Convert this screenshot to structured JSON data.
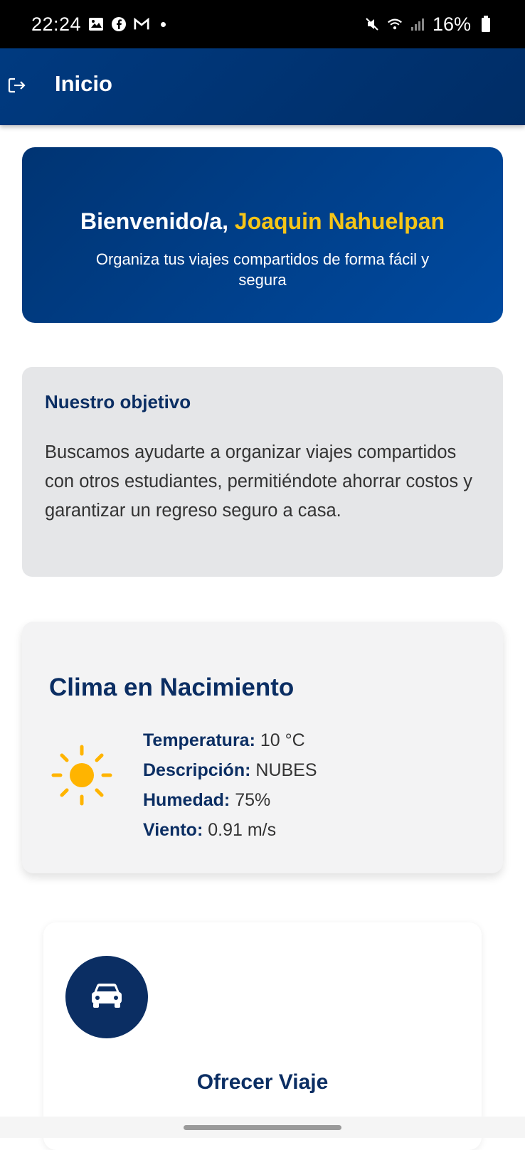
{
  "status_bar": {
    "time": "22:24",
    "battery": "16%",
    "icons": [
      "gallery-icon",
      "facebook-icon",
      "gmail-icon",
      "mute-icon",
      "wifi-icon",
      "signal-icon",
      "battery-icon"
    ]
  },
  "app_bar": {
    "title": "Inicio",
    "logout_icon": "logout-icon"
  },
  "welcome": {
    "greeting": "Bienvenido/a,",
    "name": "Joaquin Nahuelpan",
    "subtitle": "Organiza tus viajes compartidos de forma fácil y segura"
  },
  "objective": {
    "title": "Nuestro objetivo",
    "text": "Buscamos ayudarte a organizar viajes compartidos con otros estudiantes, permitiéndote ahorrar costos y garantizar un regreso seguro a casa."
  },
  "weather": {
    "title": "Clima en Nacimiento",
    "icon": "sun-icon",
    "rows": [
      {
        "label": "Temperatura:",
        "value": "10 °C"
      },
      {
        "label": "Descripción:",
        "value": "NUBES"
      },
      {
        "label": "Humedad:",
        "value": "75%"
      },
      {
        "label": "Viento:",
        "value": "0.91 m/s"
      }
    ]
  },
  "offer": {
    "icon": "car-icon",
    "label": "Ofrecer Viaje"
  },
  "colors": {
    "primary": "#0b2e63",
    "accent": "#f5c518",
    "sun": "#ffb400"
  }
}
